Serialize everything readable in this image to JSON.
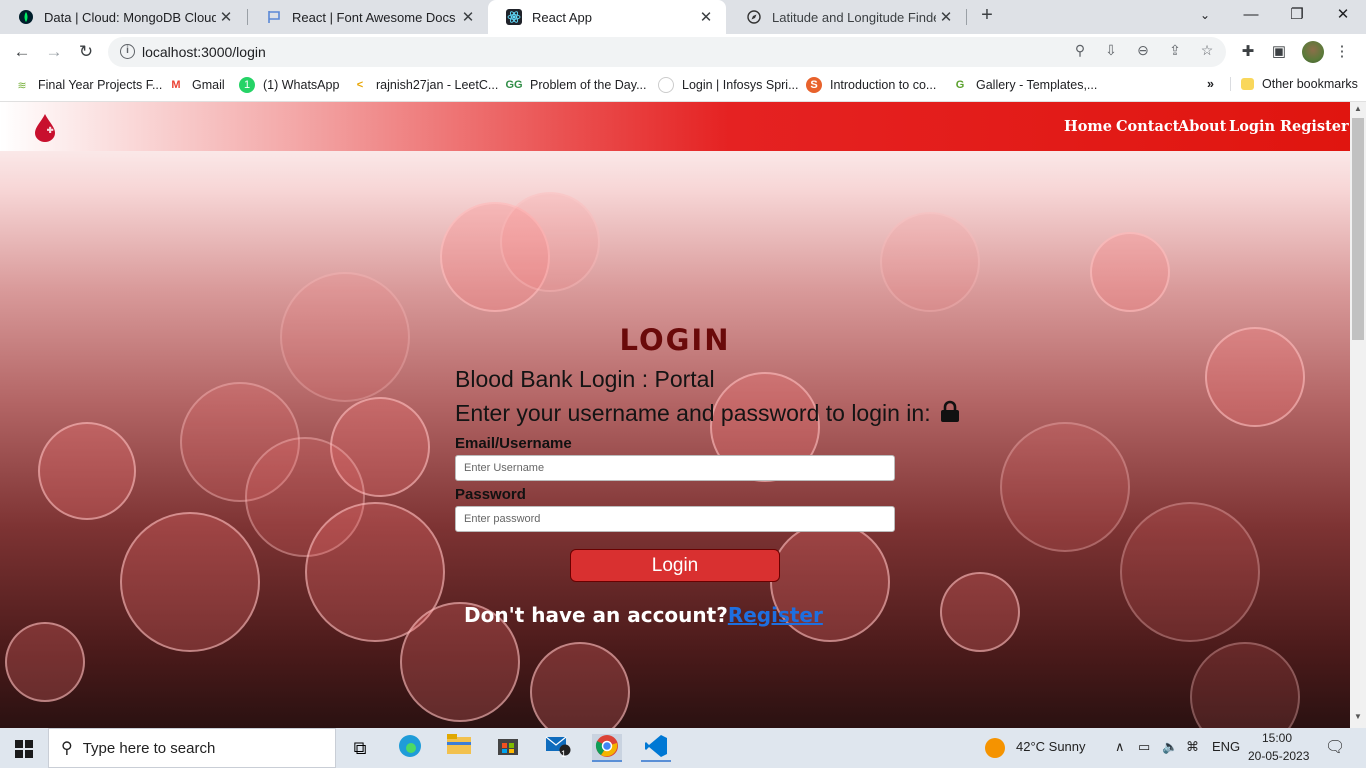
{
  "browser": {
    "tabs": [
      {
        "title": "Data | Cloud: MongoDB Cloud",
        "icon": "mongodb-icon"
      },
      {
        "title": "React | Font Awesome Docs",
        "icon": "flag-icon"
      },
      {
        "title": "React App",
        "icon": "react-icon"
      },
      {
        "title": "Latitude and Longitude Finder on",
        "icon": "compass-icon"
      }
    ],
    "url": "localhost:3000/login",
    "bookmarks": [
      "Final Year Projects F...",
      "Gmail",
      "(1) WhatsApp",
      "rajnish27jan - LeetC...",
      "Problem of the Day...",
      "Login | Infosys Spri...",
      "Introduction to co...",
      "Gallery - Templates,...",
      "Other bookmarks"
    ]
  },
  "nav": {
    "links": [
      "Home",
      "Contact",
      "About",
      "Login",
      "Register"
    ]
  },
  "login": {
    "title": "LOGIN",
    "subtitle": "Blood Bank Login : Portal",
    "instruction": "Enter your username and password to login in:",
    "username_label": "Email/Username",
    "username_placeholder": "Enter Username",
    "password_label": "Password",
    "password_placeholder": "Enter password",
    "button": "Login",
    "no_account": "Don't have an account?",
    "register_link": "Register"
  },
  "taskbar": {
    "search_placeholder": "Type here to search",
    "mail_badge": "1",
    "weather": "42°C  Sunny",
    "lang": "ENG",
    "time": "15:00",
    "date": "20-05-2023"
  },
  "colors": {
    "brand_red": "#e0150f",
    "title_dark_red": "#6a0a0a",
    "button_red": "#d93030",
    "link_blue": "#1e6fe0"
  }
}
